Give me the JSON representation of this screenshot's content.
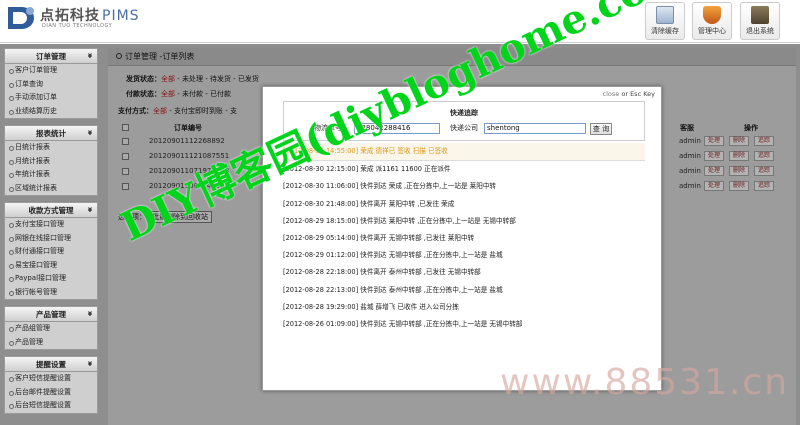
{
  "app": {
    "title": "点拓科技",
    "product": "PIMS",
    "subtitle": "DIAN TUO TECHNOLOGY"
  },
  "header_buttons": [
    {
      "label": "清除缓存",
      "icon": "cache-clear-icon"
    },
    {
      "label": "管理中心",
      "icon": "shield-icon"
    },
    {
      "label": "退出系统",
      "icon": "exit-icon"
    }
  ],
  "sidebar": [
    {
      "title": "订单管理",
      "items": [
        "客户订单管理",
        "订单查询",
        "手动添加订单",
        "业绩结算历史"
      ]
    },
    {
      "title": "报表统计",
      "items": [
        "日统计报表",
        "月统计报表",
        "年统计报表",
        "区域统计报表"
      ]
    },
    {
      "title": "收款方式管理",
      "items": [
        "支付宝接口管理",
        "网银在线接口管理",
        "财付通接口管理",
        "易宝接口管理",
        "Paypal接口管理",
        "银行帐号管理"
      ]
    },
    {
      "title": "产品管理",
      "items": [
        "产品组管理",
        "产品管理"
      ]
    },
    {
      "title": "提醒设置",
      "items": [
        "客户短信提醒设置",
        "后台邮件提醒设置",
        "后台短信提醒设置"
      ]
    }
  ],
  "content": {
    "title": "订单管理 -订单列表",
    "filters": [
      {
        "label": "发货状态：",
        "all": "全部",
        "rest": " - 未处理 - 待发货 - 已发货"
      },
      {
        "label": "付款状态：",
        "all": "全部",
        "rest": " - 未付款 - 已付款"
      },
      {
        "label": "支付方式：",
        "all": "全部",
        "rest": " - 支付宝即时到账 - 支"
      }
    ],
    "table_headers": {
      "order_no": "订单编号",
      "staff": "客服",
      "ops": "操作"
    },
    "rows": [
      {
        "order_no": "20120901112268892",
        "staff": "admin"
      },
      {
        "order_no": "20120901112108​7551",
        "staff": "admin"
      },
      {
        "order_no": "20120901107197224​8",
        "staff": "admin"
      },
      {
        "order_no": "20120901106474​7993",
        "staff": "admin"
      }
    ],
    "actions": [
      "处理",
      "删除",
      "追踪"
    ],
    "batch_label": "选中项：",
    "batch_button": "批量删除到回收站"
  },
  "modal": {
    "close_text_1": "close",
    "close_text_2": " or Esc Key",
    "title": "快递追踪",
    "order_label": "物流单号：",
    "order_value": "728042288416",
    "company_label": "快递公司",
    "company_value": "shentong",
    "query_button": "查 询",
    "lines": [
      "[2012-08-30 14:55:00] 荣成 德祥已 签收 扫描 已签收",
      "[2012-08-30 12:15:00] 荣成 派1161 11600 正在派件",
      "[2012-08-30 11:06:00] 快件到达 荣成 ,正在分拣中,上一站是 莱阳中转",
      "[2012-08-30 21:48:00] 快件离开 莱阳中转 ,已发往 荣成",
      "[2012-08-29 18:15:00] 快件到达 莱阳中转 ,正在分拣中,上一站是 无锡中转部",
      "[2012-08-29 05:14:00] 快件离开 无锡中转部 ,已发往 莱阳中转",
      "[2012-08-29 01:12:00] 快件到达 无锡中转部 ,正在分拣中,上一站是 盐城",
      "[2012-08-28 22:18:00] 快件离开 泰州中转部 ,已发往 无锡中转部",
      "[2012-08-28 22:13:00] 快件到达 泰州中转部 ,正在分拣中,上一站是 盐城",
      "[2012-08-28 19:29:00] 盐城 薛增飞 已收件 进入公司分拣",
      "[2012-08-26 01:09:00] 快件到达 无锡中转部 ,正在分拣中,上一站是 无锡中转部"
    ]
  },
  "watermarks": {
    "green": "DIY博客园(diybloghome.com)",
    "site": "www.88531.cn"
  },
  "colors": {
    "accent_red": "#8a1010",
    "watermark_green": "#00d51c",
    "highlight_line": "#d79a1e"
  }
}
